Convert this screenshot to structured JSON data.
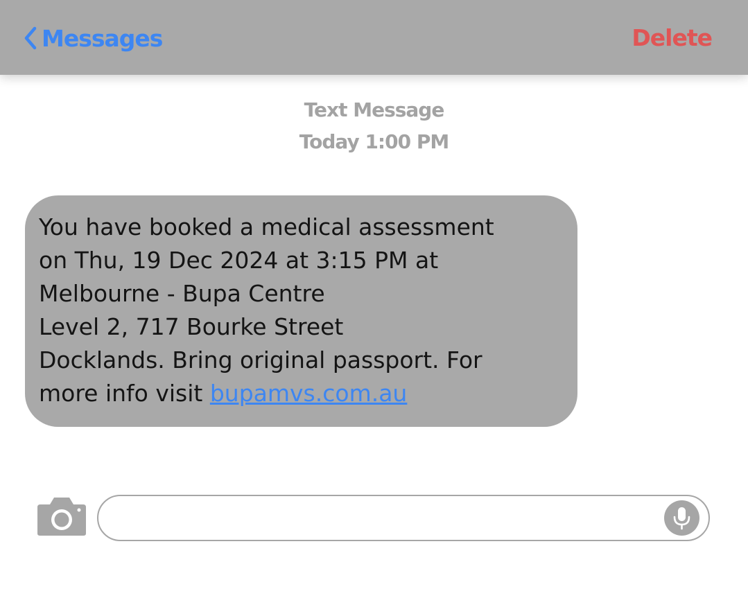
{
  "nav": {
    "back_label": "Messages",
    "delete_label": "Delete"
  },
  "header": {
    "message_type": "Text Message",
    "timestamp": "Today 1:00 PM"
  },
  "message": {
    "line1": "You have booked a medical assessment",
    "line2": "on Thu, 19 Dec 2024 at 3:15 PM at",
    "line3": "Melbourne - Bupa Centre",
    "line4": "Level 2, 717 Bourke Street",
    "line5": "Docklands. Bring original passport. For",
    "line6_prefix": "more info visit ",
    "link_text": "bupamvs.com.au"
  },
  "compose": {
    "value": "",
    "placeholder": ""
  },
  "icons": {
    "back": "chevron-left-icon",
    "camera": "camera-icon",
    "mic": "microphone-icon"
  },
  "colors": {
    "accent": "#3d86f2",
    "destructive": "#e05555",
    "bubble": "#a9a9a9",
    "navbar": "#a9a9a9"
  }
}
